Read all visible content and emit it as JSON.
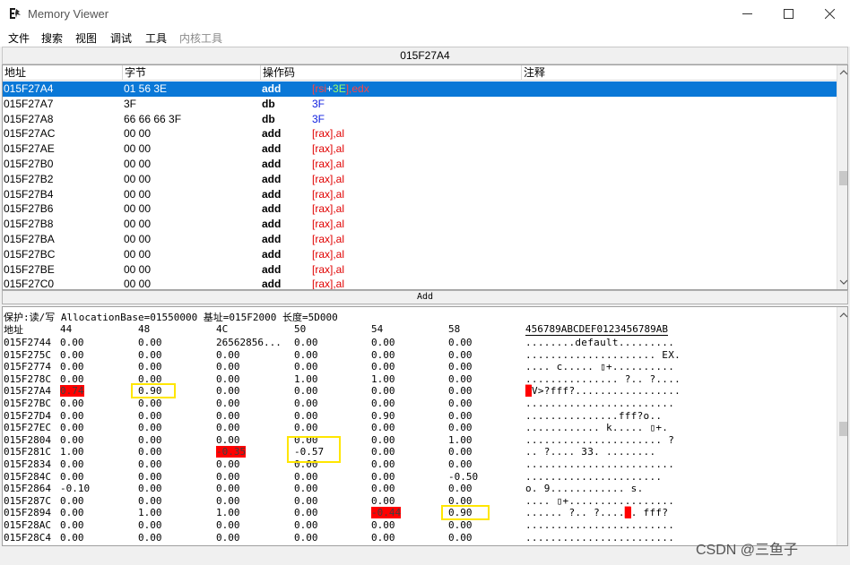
{
  "window": {
    "title": "Memory Viewer",
    "minimize_icon": "minimize-icon",
    "maximize_icon": "maximize-icon",
    "close_icon": "close-icon"
  },
  "menu": [
    "文件",
    "搜索",
    "视图",
    "调试",
    "工具",
    "内核工具"
  ],
  "disasm": {
    "current_address": "015F27A4",
    "columns": [
      "地址",
      "字节",
      "操作码",
      "注释"
    ],
    "rows": [
      {
        "addr": "015F27A4",
        "bytes": "01 56 3E",
        "op": "add",
        "args": [
          [
            "[rsi",
            "r"
          ],
          [
            "+",
            "plus"
          ],
          [
            "3E",
            "g"
          ],
          [
            "],edx",
            "r"
          ]
        ]
      },
      {
        "addr": "015F27A7",
        "bytes": "3F",
        "op": "db",
        "args": [
          [
            "3F",
            "b"
          ]
        ]
      },
      {
        "addr": "015F27A8",
        "bytes": "66 66 66 3F",
        "op": "db",
        "args": [
          [
            "3F",
            "b"
          ]
        ]
      },
      {
        "addr": "015F27AC",
        "bytes": "00 00",
        "op": "add",
        "args": [
          [
            "[rax],al",
            "r"
          ]
        ]
      },
      {
        "addr": "015F27AE",
        "bytes": "00 00",
        "op": "add",
        "args": [
          [
            "[rax],al",
            "r"
          ]
        ]
      },
      {
        "addr": "015F27B0",
        "bytes": "00 00",
        "op": "add",
        "args": [
          [
            "[rax],al",
            "r"
          ]
        ]
      },
      {
        "addr": "015F27B2",
        "bytes": "00 00",
        "op": "add",
        "args": [
          [
            "[rax],al",
            "r"
          ]
        ]
      },
      {
        "addr": "015F27B4",
        "bytes": "00 00",
        "op": "add",
        "args": [
          [
            "[rax],al",
            "r"
          ]
        ]
      },
      {
        "addr": "015F27B6",
        "bytes": "00 00",
        "op": "add",
        "args": [
          [
            "[rax],al",
            "r"
          ]
        ]
      },
      {
        "addr": "015F27B8",
        "bytes": "00 00",
        "op": "add",
        "args": [
          [
            "[rax],al",
            "r"
          ]
        ]
      },
      {
        "addr": "015F27BA",
        "bytes": "00 00",
        "op": "add",
        "args": [
          [
            "[rax],al",
            "r"
          ]
        ]
      },
      {
        "addr": "015F27BC",
        "bytes": "00 00",
        "op": "add",
        "args": [
          [
            "[rax],al",
            "r"
          ]
        ]
      },
      {
        "addr": "015F27BE",
        "bytes": "00 00",
        "op": "add",
        "args": [
          [
            "[rax],al",
            "r"
          ]
        ]
      },
      {
        "addr": "015F27C0",
        "bytes": "00 00",
        "op": "add",
        "args": [
          [
            "[rax],al",
            "r"
          ]
        ]
      }
    ],
    "add_label": "Add"
  },
  "hexview": {
    "protection_line": "保护:读/写  AllocationBase=01550000 基址=015F2000 长度=5D000",
    "header": [
      "地址",
      "44",
      "48",
      "4C",
      "50",
      "54",
      "58",
      "456789ABCDEF0123456789AB"
    ],
    "rows": [
      {
        "addr": "015F2744",
        "vals": [
          "0.00",
          "0.00",
          "26562856...",
          "0.00",
          "0.00",
          "0.00"
        ],
        "ascii": "........default........."
      },
      {
        "addr": "015F275C",
        "vals": [
          "0.00",
          "0.00",
          "0.00",
          "0.00",
          "0.00",
          "0.00"
        ],
        "ascii": "..................... EX."
      },
      {
        "addr": "015F2774",
        "vals": [
          "0.00",
          "0.00",
          "0.00",
          "0.00",
          "0.00",
          "0.00"
        ],
        "ascii": "....  c..... ▯+.........."
      },
      {
        "addr": "015F278C",
        "vals": [
          "0.00",
          "0.00",
          "0.00",
          "1.00",
          "1.00",
          "0.00"
        ],
        "ascii": "............... ?.. ?...."
      },
      {
        "addr": "015F27A4",
        "vals": [
          "0.74",
          "0.90",
          "0.00",
          "0.00",
          "0.00",
          "0.00"
        ],
        "ascii": "█V>?fff?................."
      },
      {
        "addr": "015F27BC",
        "vals": [
          "0.00",
          "0.00",
          "0.00",
          "0.00",
          "0.00",
          "0.00"
        ],
        "ascii": "........................"
      },
      {
        "addr": "015F27D4",
        "vals": [
          "0.00",
          "0.00",
          "0.00",
          "0.00",
          "0.90",
          "0.00"
        ],
        "ascii": "...............fff?o.."
      },
      {
        "addr": "015F27EC",
        "vals": [
          "0.00",
          "0.00",
          "0.00",
          "0.00",
          "0.00",
          "0.00"
        ],
        "ascii": "............  k..... ▯+."
      },
      {
        "addr": "015F2804",
        "vals": [
          "0.00",
          "0.00",
          "0.00",
          "0.00",
          "0.00",
          "1.00"
        ],
        "ascii": "...................... ?"
      },
      {
        "addr": "015F281C",
        "vals": [
          "1.00",
          "0.00",
          "-0.35",
          "-0.57",
          "0.00",
          "0.00"
        ],
        "ascii": ".. ?....     33. ........"
      },
      {
        "addr": "015F2834",
        "vals": [
          "0.00",
          "0.00",
          "0.00",
          "0.00",
          "0.00",
          "0.00"
        ],
        "ascii": "........................"
      },
      {
        "addr": "015F284C",
        "vals": [
          "0.00",
          "0.00",
          "0.00",
          "0.00",
          "0.00",
          "-0.50"
        ],
        "ascii": "......................"
      },
      {
        "addr": "015F2864",
        "vals": [
          "-0.10",
          "0.00",
          "0.00",
          "0.00",
          "0.00",
          "0.00"
        ],
        "ascii": "    o. 9............   s."
      },
      {
        "addr": "015F287C",
        "vals": [
          "0.00",
          "0.00",
          "0.00",
          "0.00",
          "0.00",
          "0.00"
        ],
        "ascii": ".... ▯+................."
      },
      {
        "addr": "015F2894",
        "vals": [
          "0.00",
          "1.00",
          "1.00",
          "0.00",
          "-0.44",
          "0.90"
        ],
        "ascii": "...... ?.. ?....█.  fff?"
      },
      {
        "addr": "015F28AC",
        "vals": [
          "0.00",
          "0.00",
          "0.00",
          "0.00",
          "0.00",
          "0.00"
        ],
        "ascii": "........................"
      },
      {
        "addr": "015F28C4",
        "vals": [
          "0.00",
          "0.00",
          "0.00",
          "0.00",
          "0.00",
          "0.00"
        ],
        "ascii": "........................"
      }
    ],
    "red_cells": [
      [
        4,
        0
      ],
      [
        9,
        2
      ],
      [
        14,
        4
      ]
    ],
    "yellow_boxes": [
      [
        4,
        1
      ],
      [
        9,
        3
      ],
      [
        14,
        5
      ]
    ]
  },
  "watermark": "CSDN @三鱼子"
}
